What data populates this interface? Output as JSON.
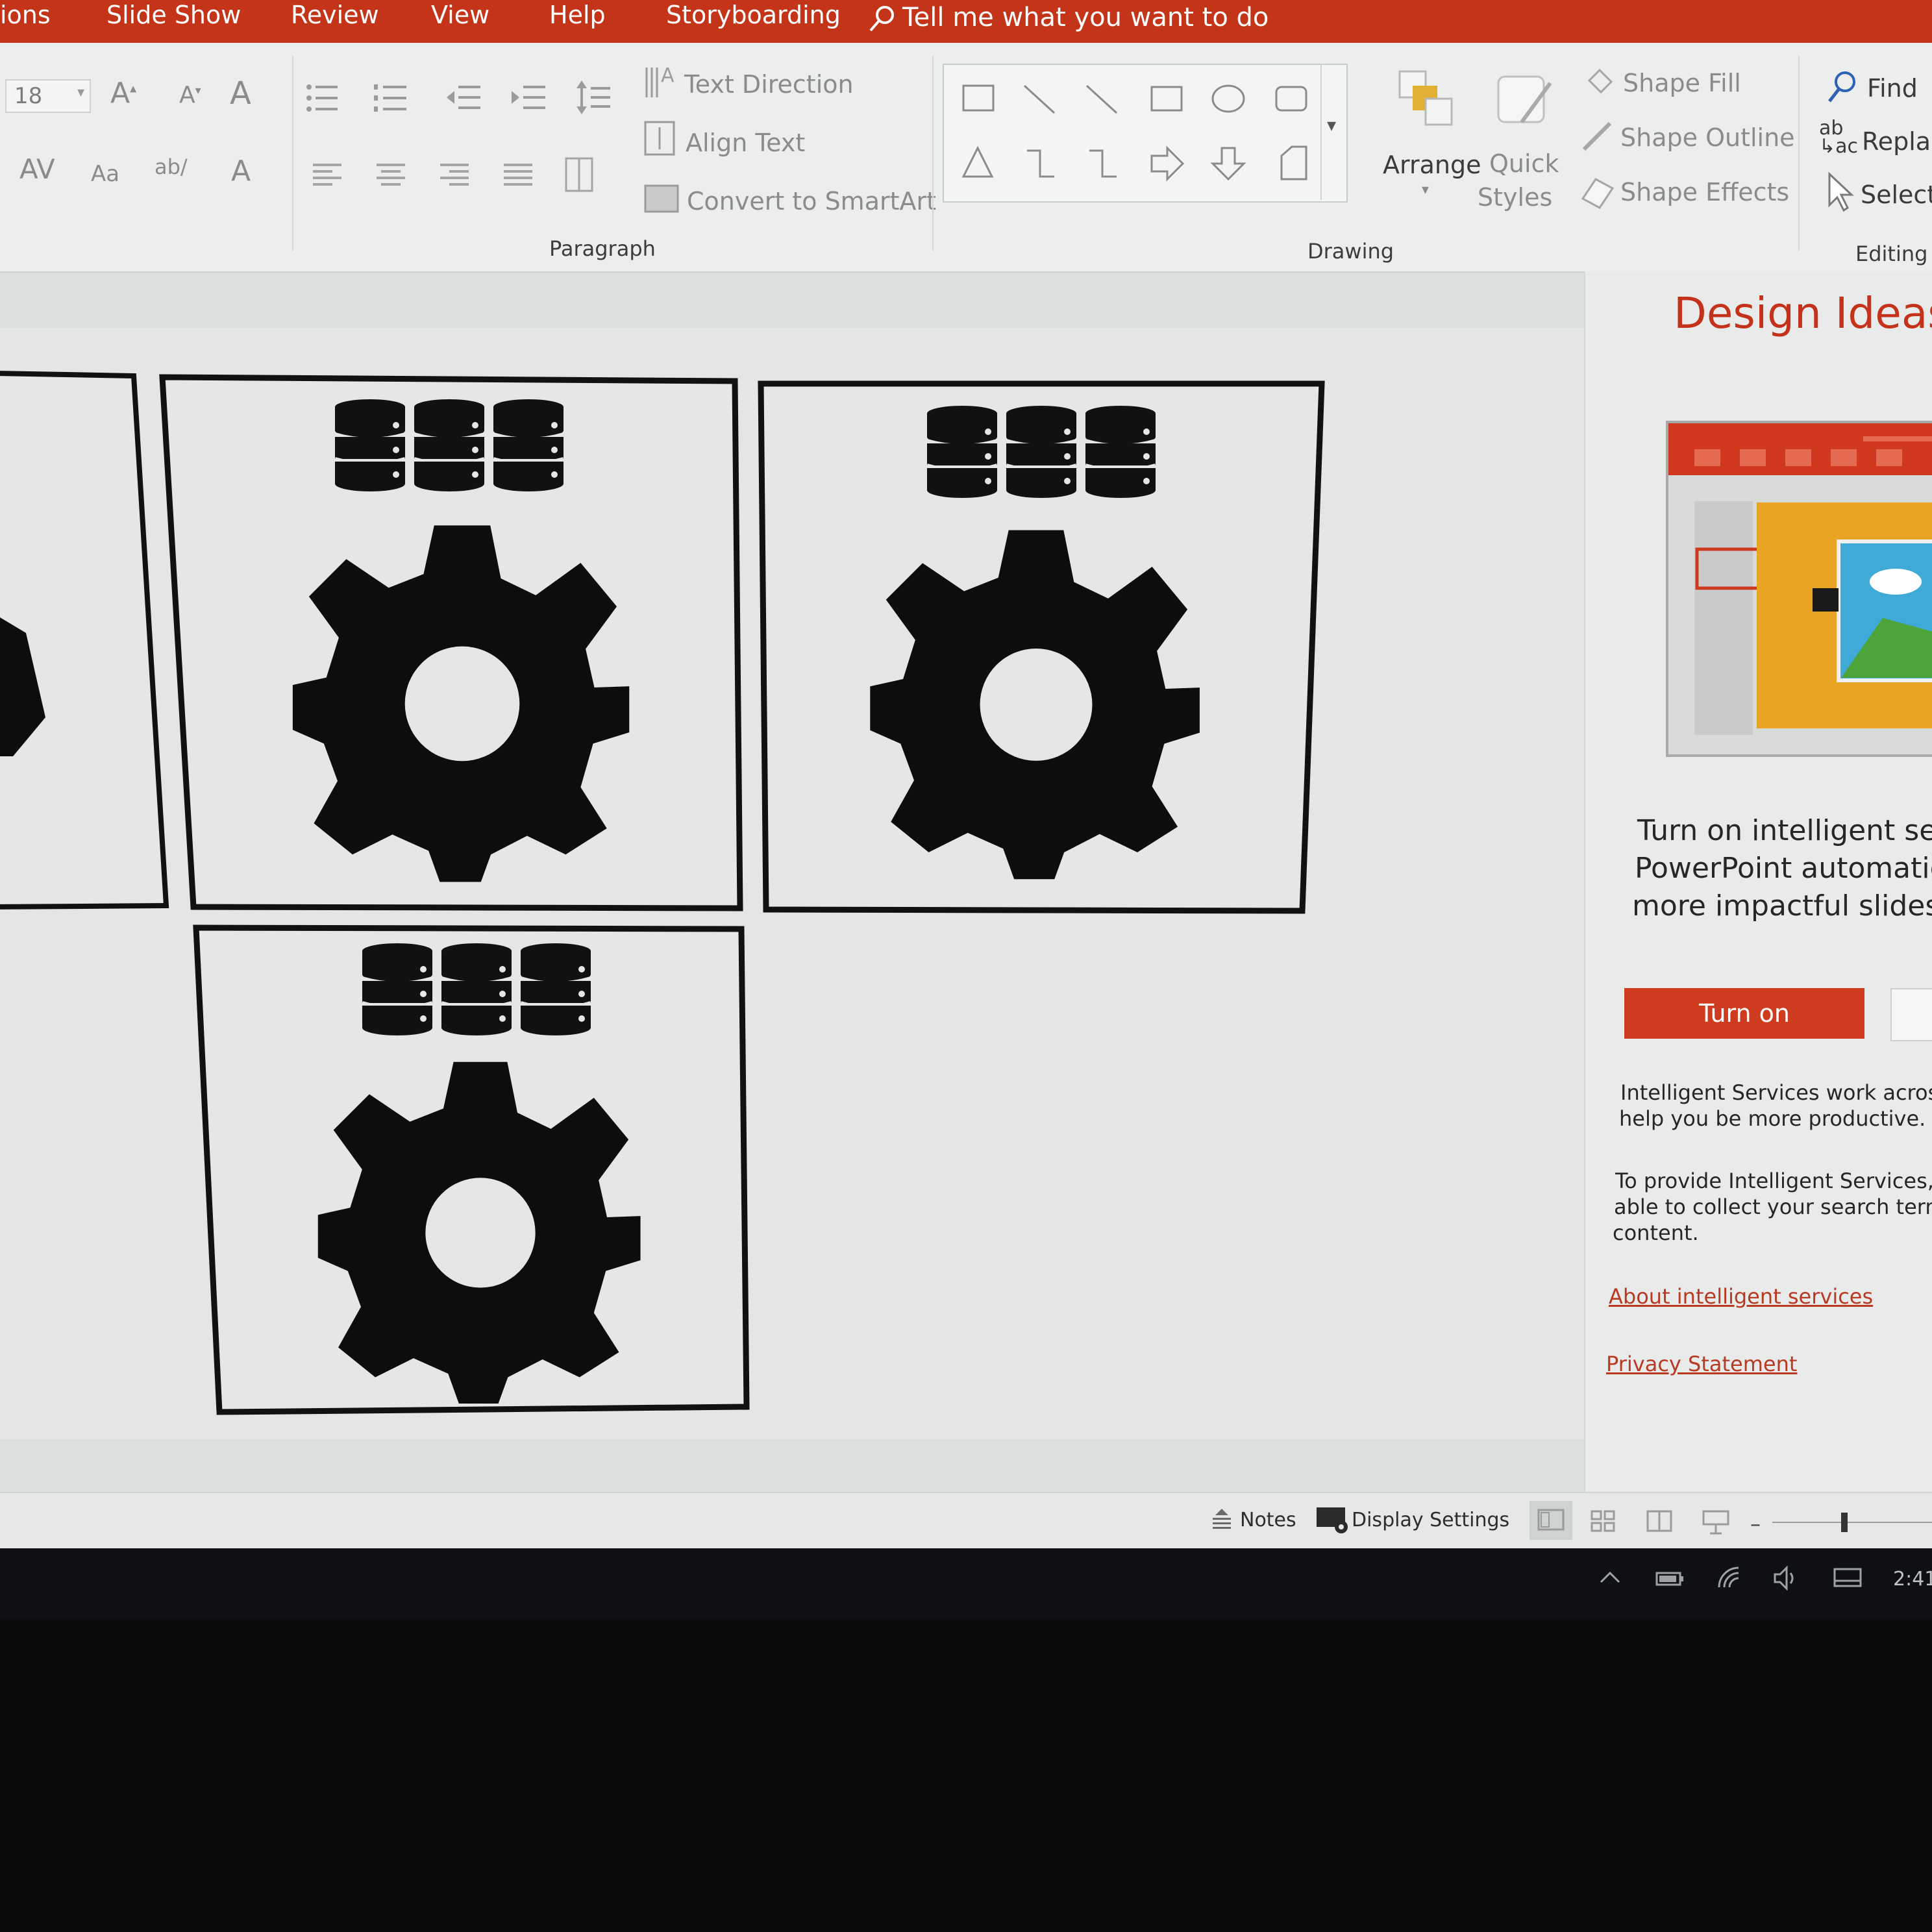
{
  "tabs": [
    "ions",
    "Slide Show",
    "Review",
    "View",
    "Help",
    "Storyboarding"
  ],
  "tell_me": "Tell me what you want to do",
  "font": {
    "size": "18"
  },
  "paragraph": {
    "text_direction": "Text Direction",
    "align_text": "Align Text",
    "convert_smartart": "Convert to SmartArt",
    "label": "Paragraph"
  },
  "drawing": {
    "arrange": "Arrange",
    "quick": "Quick",
    "styles": "Styles",
    "shape_fill": "Shape Fill",
    "shape_outline": "Shape Outline",
    "shape_effects": "Shape Effects",
    "label": "Drawing"
  },
  "editing": {
    "find": "Find",
    "replace": "Replac",
    "select": "Select",
    "label": "Editing"
  },
  "pane": {
    "title": "Design Ideas",
    "body1": "Turn on intelligent ser",
    "body2": "PowerPoint automatic",
    "body3": "more impactful slides",
    "turn_on": "Turn on",
    "note1a": "Intelligent Services work across",
    "note1b": "help you be more productive.",
    "note2a": "To provide Intelligent Services,",
    "note2b": "able to collect your search term",
    "note2c": "content.",
    "link1": "About intelligent services",
    "link2": "Privacy Statement"
  },
  "status": {
    "notes": "Notes",
    "display": "Display Settings"
  },
  "taskbar": {
    "clock": "2:41"
  },
  "colors": {
    "accent": "#c43418",
    "button": "#cf3b1f",
    "icon_dark": "#111111"
  }
}
